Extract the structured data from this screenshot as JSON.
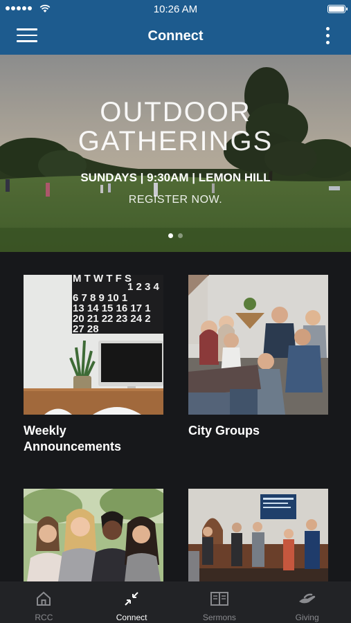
{
  "status_bar": {
    "time": "10:26 AM"
  },
  "header": {
    "title": "Connect",
    "menu_icon": "hamburger-menu-icon",
    "more_icon": "vertical-ellipsis-icon"
  },
  "hero": {
    "title_line1": "OUTDOOR",
    "title_line2": "GATHERINGS",
    "subtitle": "SUNDAYS | 9:30AM | LEMON HILL",
    "cta": "REGISTER NOW.",
    "pagination": {
      "count": 2,
      "active": 1
    }
  },
  "cards": [
    {
      "label_line1": "Weekly",
      "label_line2": "Announcements",
      "image": "calendar-desk-photo"
    },
    {
      "label_line1": "City Groups",
      "label_line2": "",
      "image": "group-on-couch-photo"
    },
    {
      "label_line1": "",
      "label_line2": "",
      "image": "women-outdoors-photo"
    },
    {
      "label_line1": "",
      "label_line2": "",
      "image": "church-stage-photo"
    }
  ],
  "calendar_photo": {
    "row1": "M T W T F S",
    "row2": "6 7 8 9 10 1",
    "row3": "13 14 15 16 17 1",
    "row4": "20 21 22 23 24 2",
    "row5": "27 28",
    "row0": "1 2 3 4"
  },
  "tabs": [
    {
      "label": "RCC",
      "icon": "home-icon",
      "active": false
    },
    {
      "label": "Connect",
      "icon": "compress-arrows-icon",
      "active": true
    },
    {
      "label": "Sermons",
      "icon": "open-book-icon",
      "active": false
    },
    {
      "label": "Giving",
      "icon": "hand-giving-icon",
      "active": false
    }
  ],
  "colors": {
    "brand_blue": "#1d5b8e",
    "background": "#17181b",
    "tabbar": "#222326",
    "tab_active": "#ffffff",
    "tab_inactive": "#8a8b8f"
  }
}
